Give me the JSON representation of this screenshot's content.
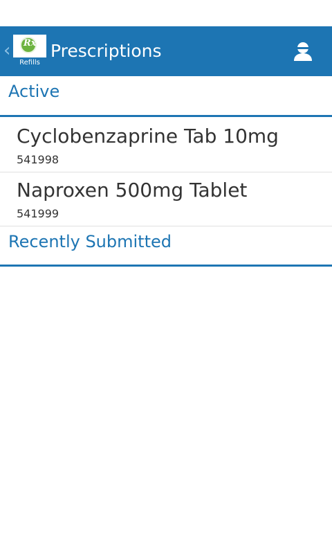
{
  "action_bar": {
    "title": "Prescriptions",
    "logo_label": "Refills",
    "logo_mark": "Rx",
    "background_color": "#1d75b3",
    "back_icon": "chevron-left-icon",
    "account_icon": "account-icon"
  },
  "sections": {
    "active": {
      "label": "Active",
      "items": [
        {
          "name": "Cyclobenzaprine Tab 10mg",
          "number": "541998"
        },
        {
          "name": "Naproxen 500mg Tablet",
          "number": "541999"
        }
      ]
    },
    "recently_submitted": {
      "label": "Recently Submitted"
    }
  },
  "colors": {
    "accent": "#1d75b3",
    "text": "#333333"
  }
}
